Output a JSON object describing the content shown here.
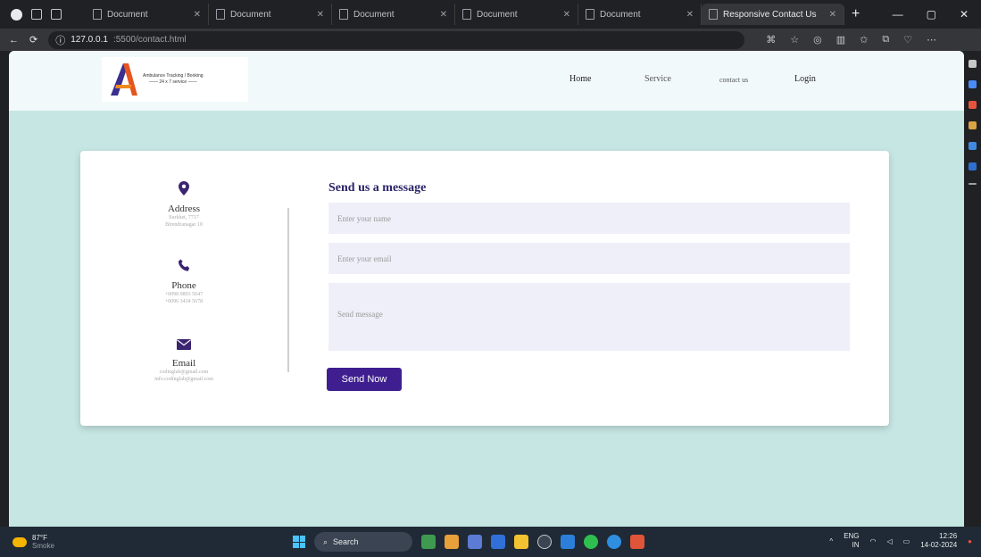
{
  "browser": {
    "tabs": [
      {
        "label": "Document"
      },
      {
        "label": "Document"
      },
      {
        "label": "Document"
      },
      {
        "label": "Document"
      },
      {
        "label": "Document"
      },
      {
        "label": "Responsive Contact Us"
      }
    ],
    "url_host": "127.0.0.1",
    "url_path": ":5500/contact.html"
  },
  "site": {
    "logo_line1": "Ambulance Tracking / Booking",
    "logo_line2": "—— 24 x 7 service ——",
    "nav": [
      "Home",
      "Service",
      "contact us",
      "Login"
    ]
  },
  "contact": {
    "address": {
      "title": "Address",
      "lines": [
        "Surkhet, 7717",
        "Birendranagar 10"
      ]
    },
    "phone": {
      "title": "Phone",
      "lines": [
        "+0098 9893 5647",
        "+0096 3434 5678"
      ]
    },
    "email": {
      "title": "Email",
      "lines": [
        "codinglab@gmail.com",
        "info.codinglab@gmail.com"
      ]
    },
    "form_title": "Send us a message",
    "name_placeholder": "Enter your name",
    "email_placeholder": "Enter your email",
    "message_placeholder": "Send message",
    "button_label": "Send Now"
  },
  "taskbar": {
    "weather_temp": "87°F",
    "weather_desc": "Smoke",
    "search_label": "Search",
    "lang": "ENG",
    "lang_sub": "IN",
    "time": "12:26",
    "date": "14-02-2024"
  },
  "colors": {
    "page_bg": "#c6e6e4",
    "accent": "#3f1f8f",
    "title": "#2a2368"
  }
}
